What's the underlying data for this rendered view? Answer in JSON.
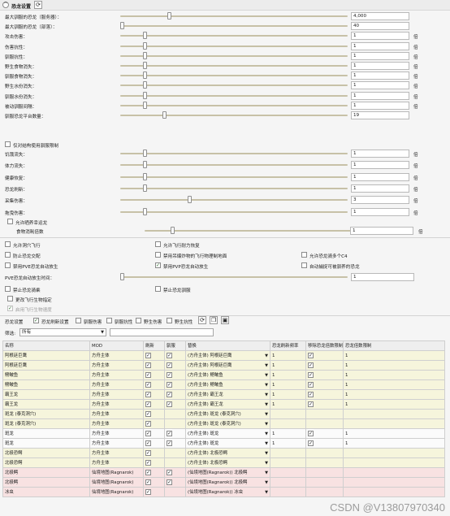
{
  "header": {
    "title": "恐龙设置",
    "toggle_icon": "^",
    "refresh_icon": "⟳"
  },
  "sliders": [
    {
      "label": "最大驯服的恐龙（服务器）：",
      "value": "4,000",
      "unit": "",
      "frac": 0.21
    },
    {
      "label": "最大驯服的恐龙（部落）：",
      "value": "40",
      "unit": "",
      "frac": 0.0
    },
    {
      "label": "攻击伤害：",
      "value": "1",
      "unit": "倍",
      "frac": 0.1
    },
    {
      "label": "伤害抗性：",
      "value": "1",
      "unit": "倍",
      "frac": 0.1
    },
    {
      "label": "驯服抗性：",
      "value": "1",
      "unit": "倍",
      "frac": 0.1
    },
    {
      "label": "野生食物消失：",
      "value": "1",
      "unit": "倍",
      "frac": 0.1
    },
    {
      "label": "驯服食物消失：",
      "value": "1",
      "unit": "倍",
      "frac": 0.1
    },
    {
      "label": "野生水份消失：",
      "value": "1",
      "unit": "倍",
      "frac": 0.1
    },
    {
      "label": "驯服水份消失：",
      "value": "1",
      "unit": "倍",
      "frac": 0.1
    },
    {
      "label": "被动驯服间隔：",
      "value": "1",
      "unit": "倍",
      "frac": 0.1
    },
    {
      "label": "驯服恐龙平台数量：",
      "value": "19",
      "unit": "",
      "frac": 0.19
    }
  ],
  "only_structures_check": {
    "label": "仅对结构使用驯服限制",
    "checked": false
  },
  "sliders2": [
    {
      "label": "饥饿流失：",
      "value": "1",
      "unit": "倍",
      "frac": 0.1
    },
    {
      "label": "体力流失：",
      "value": "1",
      "unit": "倍",
      "frac": 0.1
    },
    {
      "label": "健康恢复：",
      "value": "1",
      "unit": "倍",
      "frac": 0.1
    },
    {
      "label": "恐龙刷新：",
      "value": "1",
      "unit": "倍",
      "frac": 0.1
    },
    {
      "label": "采集伤害：",
      "value": "3",
      "unit": "倍",
      "frac": 0.3
    },
    {
      "label": "拖曳伤害：",
      "value": "1",
      "unit": "倍",
      "frac": 0.1
    }
  ],
  "allow_raft_check": {
    "label": "允许晒养幸运龙",
    "checked": false
  },
  "food_slider": {
    "label": "食物消耗倍数",
    "value": "1",
    "unit": "倍",
    "frac": 0.1
  },
  "options": [
    {
      "label": "允许洞穴飞行",
      "checked": false
    },
    {
      "label": "允许飞行耐力恢复",
      "checked": false
    },
    {
      "label": "防止恐龙交配",
      "checked": false
    },
    {
      "label": "禁用吊爆炸物的飞行物理制地面",
      "checked": false
    },
    {
      "label": "允许恐龙骑多个C4",
      "checked": false
    },
    {
      "label": "禁用PVE恐龙自动放生",
      "checked": false
    },
    {
      "label": "禁用PVP恐龙自动放生",
      "checked": true
    },
    {
      "label": "自动捕捉可被驯养的恐龙",
      "checked": false
    }
  ],
  "pve_slider": {
    "label": "PVE恐龙自动放生时间：",
    "value": "1",
    "unit": "",
    "frac": 0.0
  },
  "options2": [
    {
      "label": "禁止恐龙骑乘",
      "checked": false
    },
    {
      "label": "禁止恐龙驯服",
      "checked": false
    },
    {
      "label": "更改飞行生物指定",
      "checked": false
    },
    {
      "label": "启用飞行生物速度",
      "checked": true
    }
  ],
  "filter_toolbar": {
    "label": "恐龙设置",
    "checks": [
      {
        "label": "恐龙刷新设置",
        "checked": true
      },
      {
        "label": "驯服伤害",
        "checked": false
      },
      {
        "label": "驯服抗性",
        "checked": false
      },
      {
        "label": "野生伤害",
        "checked": false
      },
      {
        "label": "野生抗性",
        "checked": false
      }
    ],
    "filter_label": "筛选:",
    "filter_value": "所有"
  },
  "table": {
    "headers": [
      "名称",
      "MOD",
      "刷新",
      "驯服",
      "替换",
      "恐龙刷新频率",
      "移除恐龙倍数限制",
      "恐龙倍数限制"
    ],
    "rows": [
      {
        "name": "阿根廷巨鹰",
        "mod": "方舟主体",
        "spawn": true,
        "tame": true,
        "replace": "(方舟主体) 阿根廷巨鹰",
        "freq": "1",
        "remove": true,
        "limit": "1",
        "tone": "y"
      },
      {
        "name": "阿根廷巨鹰",
        "mod": "方舟主体",
        "spawn": true,
        "tame": true,
        "replace": "(方舟主体) 阿根廷巨鹰",
        "freq": "1",
        "remove": true,
        "limit": "1",
        "tone": "y"
      },
      {
        "name": "鳑鲏鱼",
        "mod": "方舟主体",
        "spawn": true,
        "tame": true,
        "replace": "(方舟主体) 鳑鲏鱼",
        "freq": "1",
        "remove": true,
        "limit": "1",
        "tone": "y"
      },
      {
        "name": "鳑鲏鱼",
        "mod": "方舟主体",
        "spawn": true,
        "tame": true,
        "replace": "(方舟主体) 鳑鲏鱼",
        "freq": "1",
        "remove": true,
        "limit": "1",
        "tone": "y"
      },
      {
        "name": "霸王龙",
        "mod": "方舟主体",
        "spawn": true,
        "tame": true,
        "replace": "(方舟主体) 霸王龙",
        "freq": "1",
        "remove": true,
        "limit": "1",
        "tone": "y"
      },
      {
        "name": "霸王龙",
        "mod": "方舟主体",
        "spawn": true,
        "tame": true,
        "replace": "(方舟主体) 霸王龙",
        "freq": "1",
        "remove": true,
        "limit": "1",
        "tone": "y"
      },
      {
        "name": "斑龙 (泰克洞穴)",
        "mod": "方舟主体",
        "spawn": true,
        "tame": false,
        "replace": "(方舟主体) 斑龙 (泰克洞穴)",
        "freq": "",
        "remove": false,
        "limit": "",
        "tone": "y"
      },
      {
        "name": "斑龙 (泰克洞穴)",
        "mod": "方舟主体",
        "spawn": true,
        "tame": false,
        "replace": "(方舟主体) 斑龙 (泰克洞穴)",
        "freq": "",
        "remove": false,
        "limit": "",
        "tone": "y"
      },
      {
        "name": "斑龙",
        "mod": "方舟主体",
        "spawn": true,
        "tame": true,
        "replace": "(方舟主体) 斑龙",
        "freq": "1",
        "remove": true,
        "limit": "1",
        "tone": "w"
      },
      {
        "name": "斑龙",
        "mod": "方舟主体",
        "spawn": true,
        "tame": true,
        "replace": "(方舟主体) 斑龙",
        "freq": "1",
        "remove": true,
        "limit": "1",
        "tone": "w"
      },
      {
        "name": "北极恐鳄",
        "mod": "方舟主体",
        "spawn": true,
        "tame": false,
        "replace": "(方舟主体) 北极恐鳄",
        "freq": "",
        "remove": false,
        "limit": "",
        "tone": "y"
      },
      {
        "name": "北极恐鳄",
        "mod": "方舟主体",
        "spawn": true,
        "tame": false,
        "replace": "(方舟主体) 北极恐鳄",
        "freq": "",
        "remove": false,
        "limit": "",
        "tone": "y"
      },
      {
        "name": "北极鳄",
        "mod": "仙境地图(Ragnarok)",
        "spawn": true,
        "tame": true,
        "replace": "(仙境地图(Ragnarok)) 北极鳄",
        "freq": "",
        "remove": false,
        "limit": "",
        "tone": "p"
      },
      {
        "name": "北极鳄",
        "mod": "仙境地图(Ragnarok)",
        "spawn": true,
        "tame": true,
        "replace": "(仙境地图(Ragnarok)) 北极鳄",
        "freq": "",
        "remove": false,
        "limit": "",
        "tone": "p"
      },
      {
        "name": "冰虫",
        "mod": "仙境地图(Ragnarok)",
        "spawn": true,
        "tame": false,
        "replace": "(仙境地图(Ragnarok)) 冰虫",
        "freq": "",
        "remove": false,
        "limit": "",
        "tone": "p"
      }
    ]
  },
  "watermark": "CSDN @V13807970340"
}
